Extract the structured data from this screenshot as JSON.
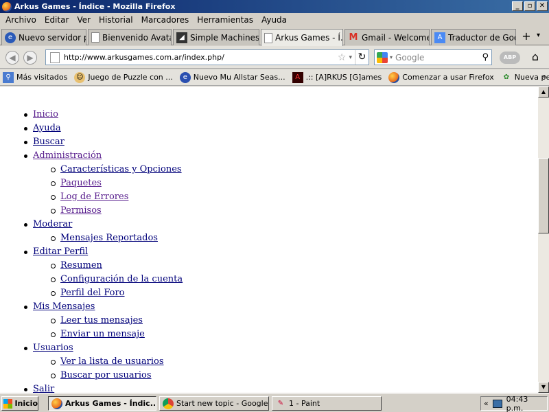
{
  "window": {
    "title": "Arkus Games - Índice - Mozilla Firefox",
    "buttons": [
      "_",
      "▫",
      "✕"
    ]
  },
  "menubar": [
    "Archivo",
    "Editar",
    "Ver",
    "Historial",
    "Marcadores",
    "Herramientas",
    "Ayuda"
  ],
  "tabs": [
    {
      "label": "Nuevo servidor pro...",
      "icon": "site-icon"
    },
    {
      "label": "Bienvenido Avatar...",
      "icon": "page-icon"
    },
    {
      "label": "Simple Machines C...",
      "icon": "smf-icon"
    },
    {
      "label": "Arkus Games - Í...",
      "icon": "page-icon",
      "active": true,
      "close": "✕"
    },
    {
      "label": "Gmail - Welcome to...",
      "icon": "gmail-icon"
    },
    {
      "label": "Traductor de Google",
      "icon": "translate-icon"
    }
  ],
  "nav": {
    "url": "http://www.arkusgames.com.ar/index.php/",
    "search_placeholder": "Google",
    "abp_label": "ABP"
  },
  "bookmarks": [
    {
      "label": "Más visitados",
      "icon": "most-visited-icon"
    },
    {
      "label": "Juego de Puzzle con ...",
      "icon": "puzzle-icon"
    },
    {
      "label": "Nuevo Mu Allstar Seas...",
      "icon": "mu-icon"
    },
    {
      "label": ".:: [A]RKUS [G]ames",
      "icon": "arkus-icon"
    },
    {
      "label": "Comenzar a usar Firefox",
      "icon": "firefox-icon"
    },
    {
      "label": "Nueva pestaña",
      "icon": "new-tab-icon"
    }
  ],
  "menu": {
    "inicio": "Inicio",
    "ayuda": "Ayuda",
    "buscar": "Buscar",
    "administracion": "Administración",
    "admin_items": [
      "Características y Opciones",
      "Paquetes",
      "Log de Errores",
      "Permisos"
    ],
    "moderar": "Moderar",
    "moderar_items": [
      "Mensajes Reportados"
    ],
    "editar_perfil": "Editar Perfil",
    "perfil_items": [
      "Resumen",
      "Configuración de la cuenta",
      "Perfil del Foro"
    ],
    "mis_mensajes": "Mis Mensajes",
    "mensajes_items": [
      "Leer tus mensajes",
      "Enviar un mensaje"
    ],
    "usuarios": "Usuarios",
    "usuarios_items": [
      "Ver la lista de usuarios",
      "Buscar por usuarios"
    ],
    "salir": "Salir"
  },
  "taskbar": {
    "start": "Inicio",
    "tasks": [
      {
        "label": "Arkus Games - Índic...",
        "icon": "firefox-icon",
        "active": true
      },
      {
        "label": "Start new topic - Google ...",
        "icon": "chrome-icon"
      },
      {
        "label": "1 - Paint",
        "icon": "paint-icon"
      }
    ],
    "tray_arrow": "«",
    "clock": "04:43 p.m."
  },
  "colors": {
    "link": "#00007a",
    "visited": "#551a8b",
    "titlebar": "#0a246a"
  }
}
